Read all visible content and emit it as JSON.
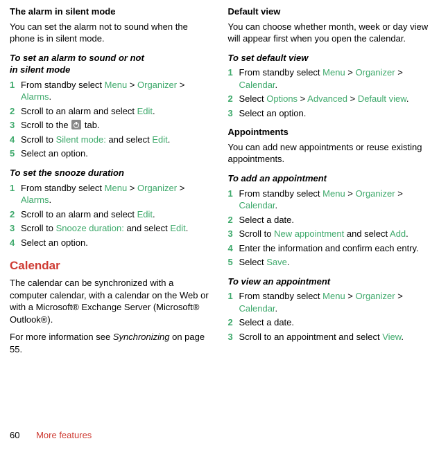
{
  "footer": {
    "page_number": "60",
    "section": "More features"
  },
  "left": {
    "alarm_head": "The alarm in silent mode",
    "alarm_body": "You can set the alarm not to sound when the phone is in silent mode.",
    "set_alarm_head_l1": "To set an alarm to sound or not",
    "set_alarm_head_l2": "in silent mode",
    "set_alarm_steps": {
      "n1": "1",
      "s1a": "From standby select ",
      "s1_menu": "Menu",
      "s1_gt": " > ",
      "s1_org": "Organizer",
      "s1_gt2": " > ",
      "s1_alarms": "Alarms",
      "s1_dot": ".",
      "n2": "2",
      "s2a": "Scroll to an alarm and select ",
      "s2_edit": "Edit",
      "s2_dot": ".",
      "n3": "3",
      "s3a": "Scroll to the ",
      "s3b": " tab.",
      "n4": "4",
      "s4a": "Scroll to ",
      "s4_silent": "Silent mode:",
      "s4b": " and select ",
      "s4_edit": "Edit",
      "s4_dot": ".",
      "n5": "5",
      "s5a": "Select an option."
    },
    "snooze_head": "To set the snooze duration",
    "snooze_steps": {
      "n1": "1",
      "s1a": "From standby select ",
      "s1_menu": "Menu",
      "s1_gt": " > ",
      "s1_org": "Organizer",
      "s1_gt2": " > ",
      "s1_alarms": "Alarms",
      "s1_dot": ".",
      "n2": "2",
      "s2a": "Scroll to an alarm and select ",
      "s2_edit": "Edit",
      "s2_dot": ".",
      "n3": "3",
      "s3a": "Scroll to ",
      "s3_snooze": "Snooze duration:",
      "s3b": " and select ",
      "s3_edit": "Edit",
      "s3_dot": ".",
      "n4": "4",
      "s4a": "Select an option."
    },
    "cal_head": "Calendar",
    "cal_body": "The calendar can be synchronized with a computer calendar, with a calendar on the Web or with a Microsoft® Exchange Server (Microsoft® Outlook®).",
    "cal_more_a": "For more information see ",
    "cal_more_b": "Synchronizing",
    "cal_more_c": " on page 55."
  },
  "right": {
    "def_head": "Default view",
    "def_body": "You can choose whether month, week or day view will appear first when you open the calendar.",
    "set_def_head": "To set default view",
    "set_def_steps": {
      "n1": "1",
      "s1a": "From standby select ",
      "s1_menu": "Menu",
      "s1_gt": " > ",
      "s1_org": "Organizer",
      "s1_gt2": " > ",
      "s1_cal": "Calendar",
      "s1_dot": ".",
      "n2": "2",
      "s2a": "Select ",
      "s2_opt": "Options",
      "s2_gt": " > ",
      "s2_adv": "Advanced",
      "s2_gt2": " > ",
      "s2_dv": "Default view",
      "s2_dot": ".",
      "n3": "3",
      "s3a": "Select an option."
    },
    "app_head": "Appointments",
    "app_body": "You can add new appointments or reuse existing appointments.",
    "add_head": "To add an appointment",
    "add_steps": {
      "n1": "1",
      "s1a": "From standby select ",
      "s1_menu": "Menu",
      "s1_gt": " > ",
      "s1_org": "Organizer",
      "s1_gt2": " > ",
      "s1_cal": "Calendar",
      "s1_dot": ".",
      "n2": "2",
      "s2a": "Select a date.",
      "n3": "3",
      "s3a": "Scroll to ",
      "s3_new": "New appointment",
      "s3b": " and select ",
      "s3_add": "Add",
      "s3_dot": ".",
      "n4": "4",
      "s4a": "Enter the information and confirm each entry.",
      "n5": "5",
      "s5a": "Select ",
      "s5_save": "Save",
      "s5_dot": "."
    },
    "view_head": "To view an appointment",
    "view_steps": {
      "n1": "1",
      "s1a": "From standby select ",
      "s1_menu": "Menu",
      "s1_gt": " > ",
      "s1_org": "Organizer",
      "s1_gt2": " > ",
      "s1_cal": "Calendar",
      "s1_dot": ".",
      "n2": "2",
      "s2a": "Select a date.",
      "n3": "3",
      "s3a": "Scroll to an appointment and select ",
      "s3_view": "View",
      "s3_dot": "."
    }
  }
}
